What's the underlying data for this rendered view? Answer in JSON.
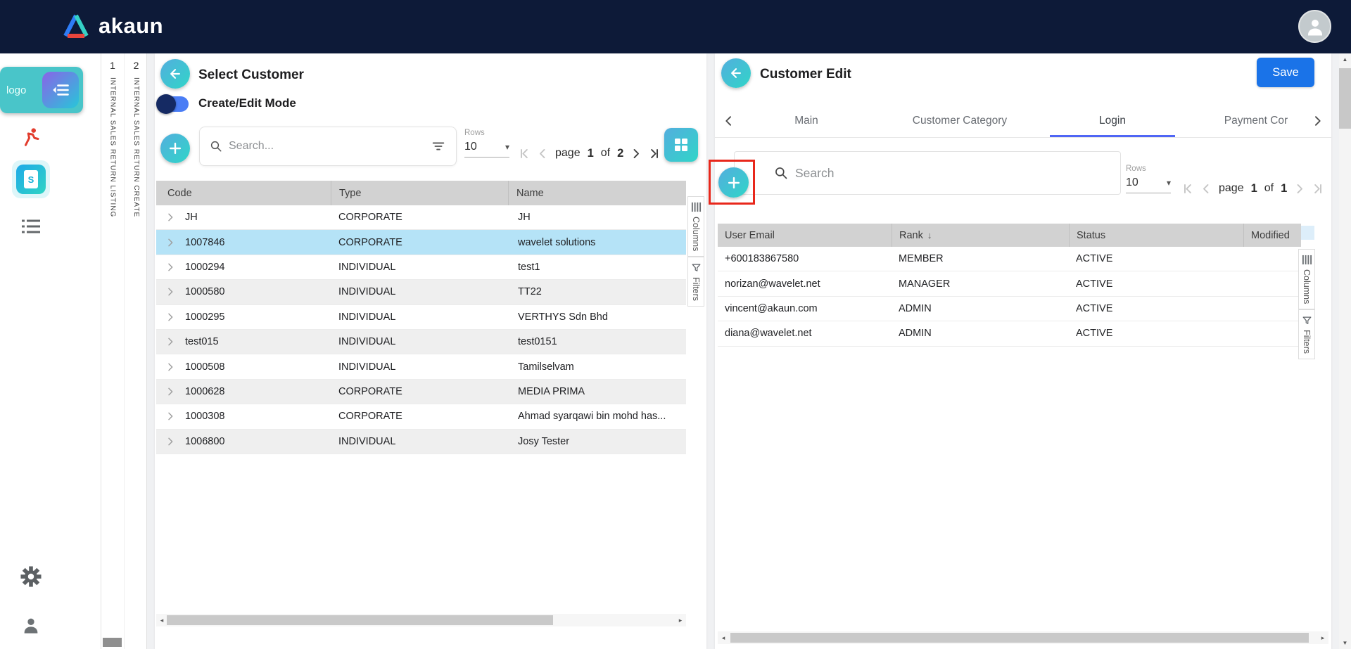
{
  "topbar": {
    "brand": "akaun"
  },
  "sidebar": {
    "logo_alt": "logo",
    "doc_icon_letter": "S"
  },
  "nav_strip": {
    "tabs": [
      {
        "number": "1",
        "label": "INTERNAL SALES RETURN LISTING"
      },
      {
        "number": "2",
        "label": "INTERNAL SALES RETURN CREATE"
      }
    ]
  },
  "left_panel": {
    "title": "Select Customer",
    "toggle_label": "Create/Edit Mode",
    "search_placeholder": "Search...",
    "rows_label": "Rows",
    "rows_value": "10",
    "pagination": {
      "page_label": "page",
      "page": "1",
      "of_label": "of",
      "total": "2"
    },
    "side_tabs": {
      "columns": "Columns",
      "filters": "Filters"
    },
    "table": {
      "columns": [
        "Code",
        "Type",
        "Name"
      ],
      "rows": [
        {
          "code": "JH",
          "type": "CORPORATE",
          "name": "JH",
          "selected": false
        },
        {
          "code": "1007846",
          "type": "CORPORATE",
          "name": "wavelet solutions",
          "selected": true
        },
        {
          "code": "1000294",
          "type": "INDIVIDUAL",
          "name": "test1",
          "selected": false
        },
        {
          "code": "1000580",
          "type": "INDIVIDUAL",
          "name": "TT22",
          "selected": false
        },
        {
          "code": "1000295",
          "type": "INDIVIDUAL",
          "name": "VERTHYS Sdn Bhd",
          "selected": false
        },
        {
          "code": "test015",
          "type": "INDIVIDUAL",
          "name": "test0151",
          "selected": false
        },
        {
          "code": "1000508",
          "type": "INDIVIDUAL",
          "name": "Tamilselvam",
          "selected": false
        },
        {
          "code": "1000628",
          "type": "CORPORATE",
          "name": "MEDIA PRIMA",
          "selected": false
        },
        {
          "code": "1000308",
          "type": "CORPORATE",
          "name": "Ahmad syarqawi bin mohd has...",
          "selected": false
        },
        {
          "code": "1006800",
          "type": "INDIVIDUAL",
          "name": "Josy Tester",
          "selected": false
        }
      ]
    }
  },
  "right_panel": {
    "title": "Customer Edit",
    "save_label": "Save",
    "tabs": [
      {
        "label": "Main",
        "active": false
      },
      {
        "label": "Customer Category",
        "active": false
      },
      {
        "label": "Login",
        "active": true
      },
      {
        "label": "Payment Cor",
        "active": false
      }
    ],
    "search_placeholder": "Search",
    "rows_label": "Rows",
    "rows_value": "10",
    "pagination": {
      "page_label": "page",
      "page": "1",
      "of_label": "of",
      "total": "1"
    },
    "side_tabs": {
      "columns": "Columns",
      "filters": "Filters"
    },
    "table": {
      "columns": [
        "User Email",
        "Rank",
        "Status",
        "Modified"
      ],
      "sort_column": "Rank",
      "sort_icon": "↓",
      "rows": [
        {
          "email": "+600183867580",
          "rank": "MEMBER",
          "status": "ACTIVE",
          "modified": ""
        },
        {
          "email": "norizan@wavelet.net",
          "rank": "MANAGER",
          "status": "ACTIVE",
          "modified": ""
        },
        {
          "email": "vincent@akaun.com",
          "rank": "ADMIN",
          "status": "ACTIVE",
          "modified": ""
        },
        {
          "email": "diana@wavelet.net",
          "rank": "ADMIN",
          "status": "ACTIVE",
          "modified": ""
        }
      ]
    }
  },
  "colors": {
    "topbar_bg": "#0d1a38",
    "accent_gradient_start": "#53aede",
    "accent_gradient_end": "#30d5c8",
    "save_button": "#1a73e8",
    "selected_row": "#b5e3f7",
    "table_header_bg": "#d2d2d2",
    "active_tab_underline": "#5066f5",
    "highlight_box": "#e8271b"
  }
}
